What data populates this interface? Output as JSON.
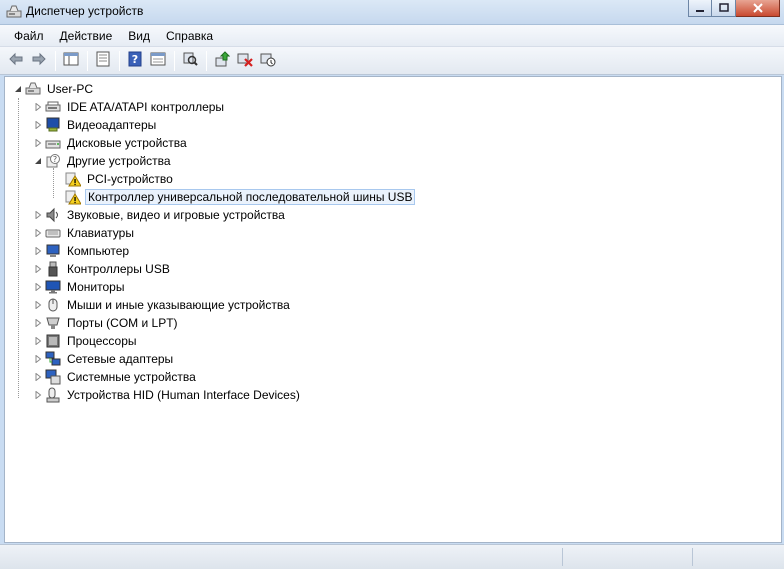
{
  "window": {
    "title": "Диспетчер устройств"
  },
  "menu": [
    "Файл",
    "Действие",
    "Вид",
    "Справка"
  ],
  "toolbar": [
    {
      "name": "back-icon"
    },
    {
      "name": "forward-icon"
    },
    {
      "sep": true
    },
    {
      "name": "show-hide-console-tree-icon"
    },
    {
      "sep": true
    },
    {
      "name": "properties-icon"
    },
    {
      "sep": true
    },
    {
      "name": "help-icon"
    },
    {
      "name": "view-icon"
    },
    {
      "sep": true
    },
    {
      "name": "scan-hardware-icon"
    },
    {
      "sep": true
    },
    {
      "name": "update-driver-icon"
    },
    {
      "name": "uninstall-icon"
    },
    {
      "name": "disable-device-icon"
    }
  ],
  "tree": {
    "root": "User-PC",
    "items": [
      {
        "label": "IDE ATA/ATAPI контроллеры",
        "icon": "ide-controller-icon",
        "expanded": false
      },
      {
        "label": "Видеоадаптеры",
        "icon": "display-adapter-icon",
        "expanded": false
      },
      {
        "label": "Дисковые устройства",
        "icon": "disk-drive-icon",
        "expanded": false
      },
      {
        "label": "Другие устройства",
        "icon": "other-devices-icon",
        "expanded": true,
        "children": [
          {
            "label": "PCI-устройство",
            "icon": "warning-device-icon"
          },
          {
            "label": "Контроллер универсальной последовательной шины USB",
            "icon": "warning-device-icon",
            "selected": true
          }
        ]
      },
      {
        "label": "Звуковые, видео и игровые устройства",
        "icon": "sound-icon",
        "expanded": false
      },
      {
        "label": "Клавиатуры",
        "icon": "keyboard-icon",
        "expanded": false
      },
      {
        "label": "Компьютер",
        "icon": "computer-icon",
        "expanded": false
      },
      {
        "label": "Контроллеры USB",
        "icon": "usb-icon",
        "expanded": false
      },
      {
        "label": "Мониторы",
        "icon": "monitor-icon",
        "expanded": false
      },
      {
        "label": "Мыши и иные указывающие устройства",
        "icon": "mouse-icon",
        "expanded": false
      },
      {
        "label": "Порты (COM и LPT)",
        "icon": "port-icon",
        "expanded": false
      },
      {
        "label": "Процессоры",
        "icon": "processor-icon",
        "expanded": false
      },
      {
        "label": "Сетевые адаптеры",
        "icon": "network-adapter-icon",
        "expanded": false
      },
      {
        "label": "Системные устройства",
        "icon": "system-devices-icon",
        "expanded": false
      },
      {
        "label": "Устройства HID (Human Interface Devices)",
        "icon": "hid-icon",
        "expanded": false
      }
    ]
  }
}
